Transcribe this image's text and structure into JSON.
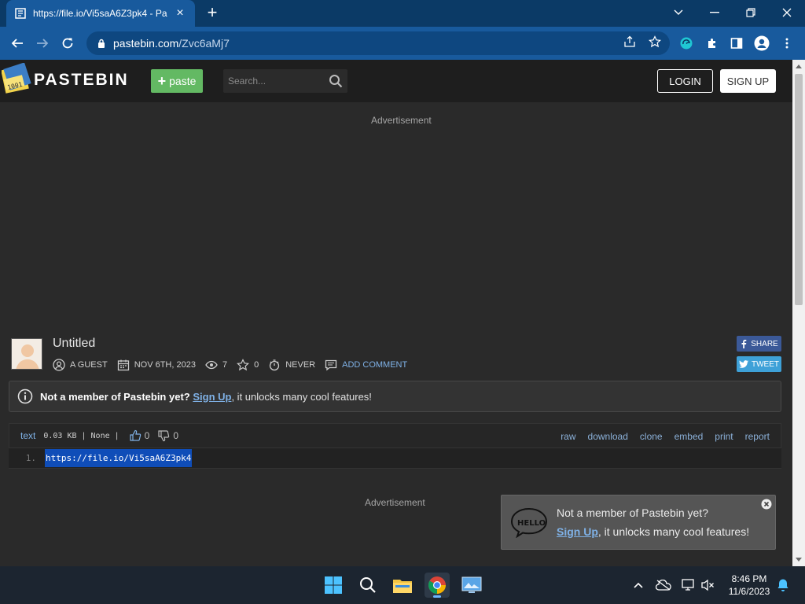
{
  "browser": {
    "tab_title": "https://file.io/Vi5saA6Z3pk4 - Pa",
    "url_domain": "pastebin.com",
    "url_path": "/Zvc6aMj7"
  },
  "site": {
    "logo_text": "PASTEBIN",
    "paste_button": "paste",
    "search_placeholder": "Search...",
    "login": "LOGIN",
    "signup": "SIGN UP",
    "advertisement": "Advertisement"
  },
  "paste": {
    "title": "Untitled",
    "author": "A GUEST",
    "date": "NOV 6TH, 2023",
    "views": "7",
    "stars": "0",
    "expiry": "NEVER",
    "add_comment": "ADD COMMENT",
    "share": "SHARE",
    "tweet": "TWEET"
  },
  "notice": {
    "bold": "Not a member of Pastebin yet?",
    "link": "Sign Up",
    "rest": ", it unlocks many cool features!"
  },
  "code_bar": {
    "syntax": "text",
    "size": "0.03 KB",
    "sep1": "|",
    "category": "None",
    "sep2": "|",
    "likes": "0",
    "dislikes": "0",
    "actions": [
      "raw",
      "download",
      "clone",
      "embed",
      "print",
      "report"
    ]
  },
  "code": {
    "line_number": "1.",
    "content": "https://file.io/Vi5saA6Z3pk4"
  },
  "toast": {
    "line1": "Not a member of Pastebin yet?",
    "link": "Sign Up",
    "line2_rest": ", it unlocks many cool features!"
  },
  "taskbar": {
    "time": "8:46 PM",
    "date": "11/6/2023"
  },
  "colors": {
    "chrome": "#185a9d",
    "accent_green": "#63b963",
    "link_blue": "#7fb1e6",
    "facebook": "#3b5998",
    "twitter": "#3ea1d8"
  }
}
